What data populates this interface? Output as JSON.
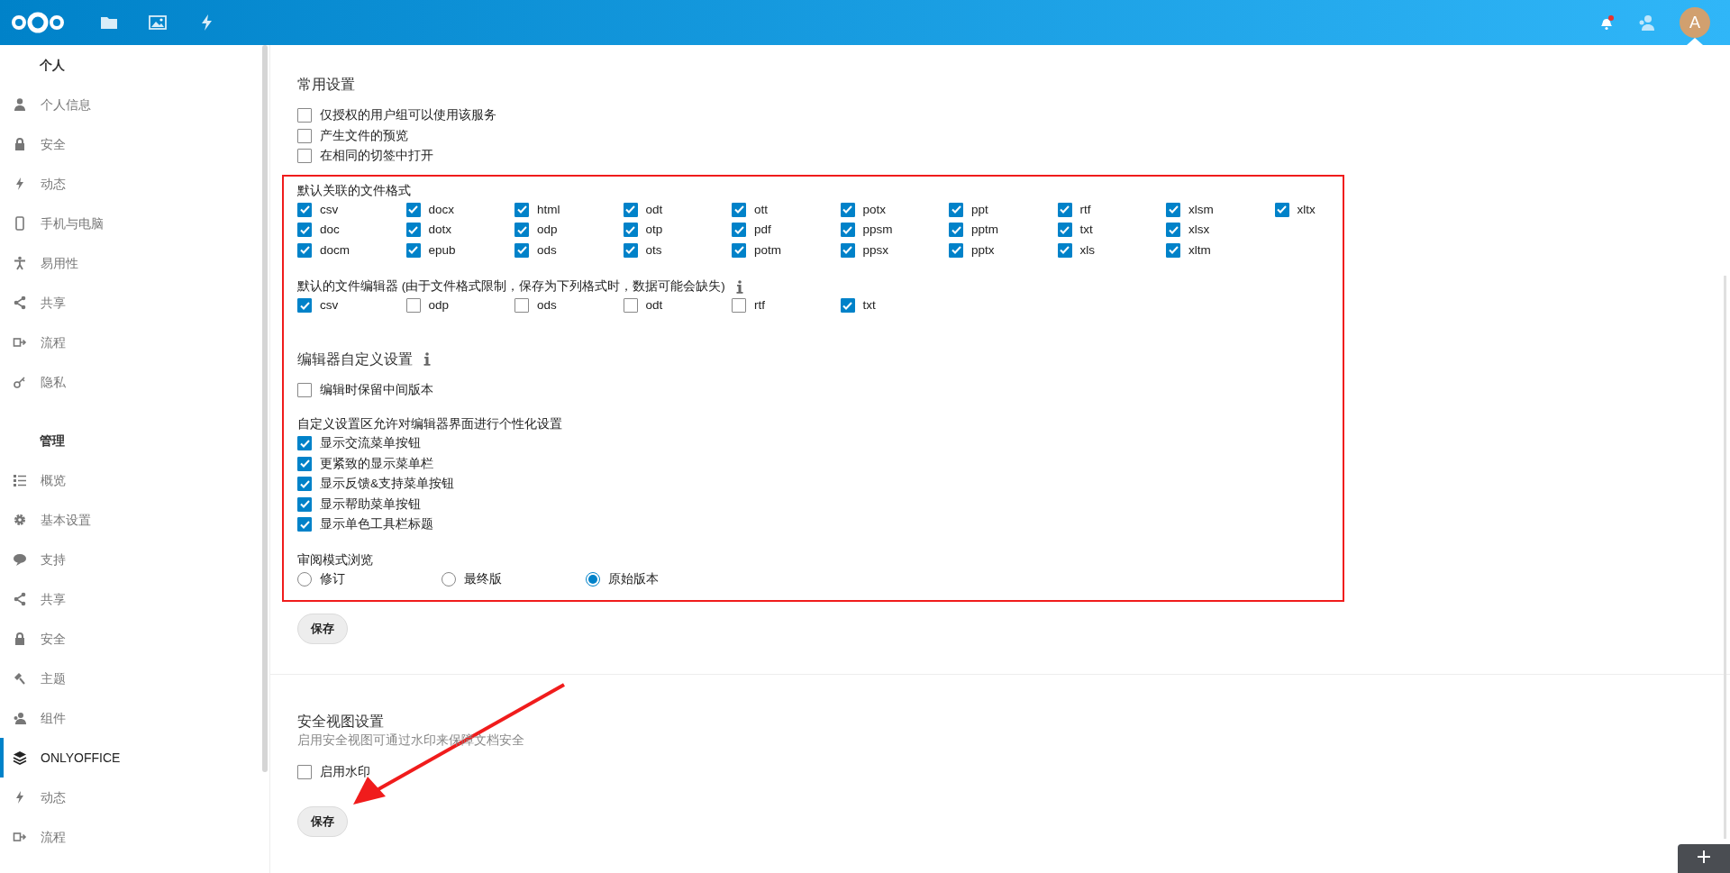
{
  "topbar": {
    "apps": [
      {
        "kind": "files"
      },
      {
        "kind": "photos"
      },
      {
        "kind": "activity"
      }
    ],
    "notification": true,
    "avatar": "A"
  },
  "sidebar": {
    "sections": [
      {
        "heading": "个人",
        "items": [
          {
            "label": "个人信息",
            "kind": "person",
            "selected": false
          },
          {
            "label": "安全",
            "kind": "lock",
            "selected": false
          },
          {
            "label": "动态",
            "kind": "bolt",
            "selected": false
          },
          {
            "label": "手机与电脑",
            "kind": "phone",
            "selected": false
          },
          {
            "label": "易用性",
            "kind": "access",
            "selected": false
          },
          {
            "label": "共享",
            "kind": "share",
            "selected": false
          },
          {
            "label": "流程",
            "kind": "flow",
            "selected": false
          },
          {
            "label": "隐私",
            "kind": "key",
            "selected": false
          }
        ]
      },
      {
        "heading": "管理",
        "items": [
          {
            "label": "概览",
            "kind": "list",
            "selected": false
          },
          {
            "label": "基本设置",
            "kind": "gear",
            "selected": false
          },
          {
            "label": "支持",
            "kind": "chat",
            "selected": false
          },
          {
            "label": "共享",
            "kind": "share",
            "selected": false
          },
          {
            "label": "安全",
            "kind": "lock",
            "selected": false
          },
          {
            "label": "主题",
            "kind": "brush",
            "selected": false
          },
          {
            "label": "组件",
            "kind": "contacts",
            "selected": false
          },
          {
            "label": "ONLYOFFICE",
            "kind": "layers",
            "selected": true
          },
          {
            "label": "动态",
            "kind": "bolt",
            "selected": false
          },
          {
            "label": "流程",
            "kind": "flow",
            "selected": false
          }
        ]
      }
    ]
  },
  "general": {
    "title": "常用设置",
    "options": [
      {
        "label": "仅授权的用户组可以使用该服务",
        "checked": false
      },
      {
        "label": "产生文件的预览",
        "checked": false
      },
      {
        "label": "在相同的切签中打开",
        "checked": false
      }
    ]
  },
  "formats": {
    "title": "默认关联的文件格式",
    "items": [
      {
        "label": "csv",
        "checked": true
      },
      {
        "label": "doc",
        "checked": true
      },
      {
        "label": "docm",
        "checked": true
      },
      {
        "label": "docx",
        "checked": true
      },
      {
        "label": "dotx",
        "checked": true
      },
      {
        "label": "epub",
        "checked": true
      },
      {
        "label": "html",
        "checked": true
      },
      {
        "label": "odp",
        "checked": true
      },
      {
        "label": "ods",
        "checked": true
      },
      {
        "label": "odt",
        "checked": true
      },
      {
        "label": "otp",
        "checked": true
      },
      {
        "label": "ots",
        "checked": true
      },
      {
        "label": "ott",
        "checked": true
      },
      {
        "label": "pdf",
        "checked": true
      },
      {
        "label": "potm",
        "checked": true
      },
      {
        "label": "potx",
        "checked": true
      },
      {
        "label": "ppsm",
        "checked": true
      },
      {
        "label": "ppsx",
        "checked": true
      },
      {
        "label": "ppt",
        "checked": true
      },
      {
        "label": "pptm",
        "checked": true
      },
      {
        "label": "pptx",
        "checked": true
      },
      {
        "label": "rtf",
        "checked": true
      },
      {
        "label": "txt",
        "checked": true
      },
      {
        "label": "xls",
        "checked": true
      },
      {
        "label": "xlsm",
        "checked": true
      },
      {
        "label": "xlsx",
        "checked": true
      },
      {
        "label": "xltm",
        "checked": true
      },
      {
        "label": "xltx",
        "checked": true
      }
    ]
  },
  "editors": {
    "title": "默认的文件编辑器 (由于文件格式限制，保存为下列格式时，数据可能会缺失)",
    "items": [
      {
        "label": "csv",
        "checked": true
      },
      {
        "label": "odp",
        "checked": false
      },
      {
        "label": "ods",
        "checked": false
      },
      {
        "label": "odt",
        "checked": false
      },
      {
        "label": "rtf",
        "checked": false
      },
      {
        "label": "txt",
        "checked": true
      }
    ]
  },
  "customization": {
    "title": "编辑器自定义设置",
    "options": [
      {
        "label": "编辑时保留中间版本",
        "checked": false
      }
    ],
    "subtitle": "自定义设置区允许对编辑器界面进行个性化设置",
    "features": [
      {
        "label": "显示交流菜单按钮",
        "checked": true
      },
      {
        "label": "更紧致的显示菜单栏",
        "checked": true
      },
      {
        "label": "显示反馈&支持菜单按钮",
        "checked": true
      },
      {
        "label": "显示帮助菜单按钮",
        "checked": true
      },
      {
        "label": "显示单色工具栏标题",
        "checked": true
      }
    ]
  },
  "review": {
    "title": "审阅模式浏览",
    "options": [
      {
        "label": "修订",
        "selected": false
      },
      {
        "label": "最终版",
        "selected": false
      },
      {
        "label": "原始版本",
        "selected": true
      }
    ]
  },
  "save_button": "保存",
  "secure_view": {
    "title": "安全视图设置",
    "description": "启用安全视图可通过水印来保障文档安全",
    "options": [
      {
        "label": "启用水印",
        "checked": false
      }
    ],
    "save_button": "保存"
  }
}
